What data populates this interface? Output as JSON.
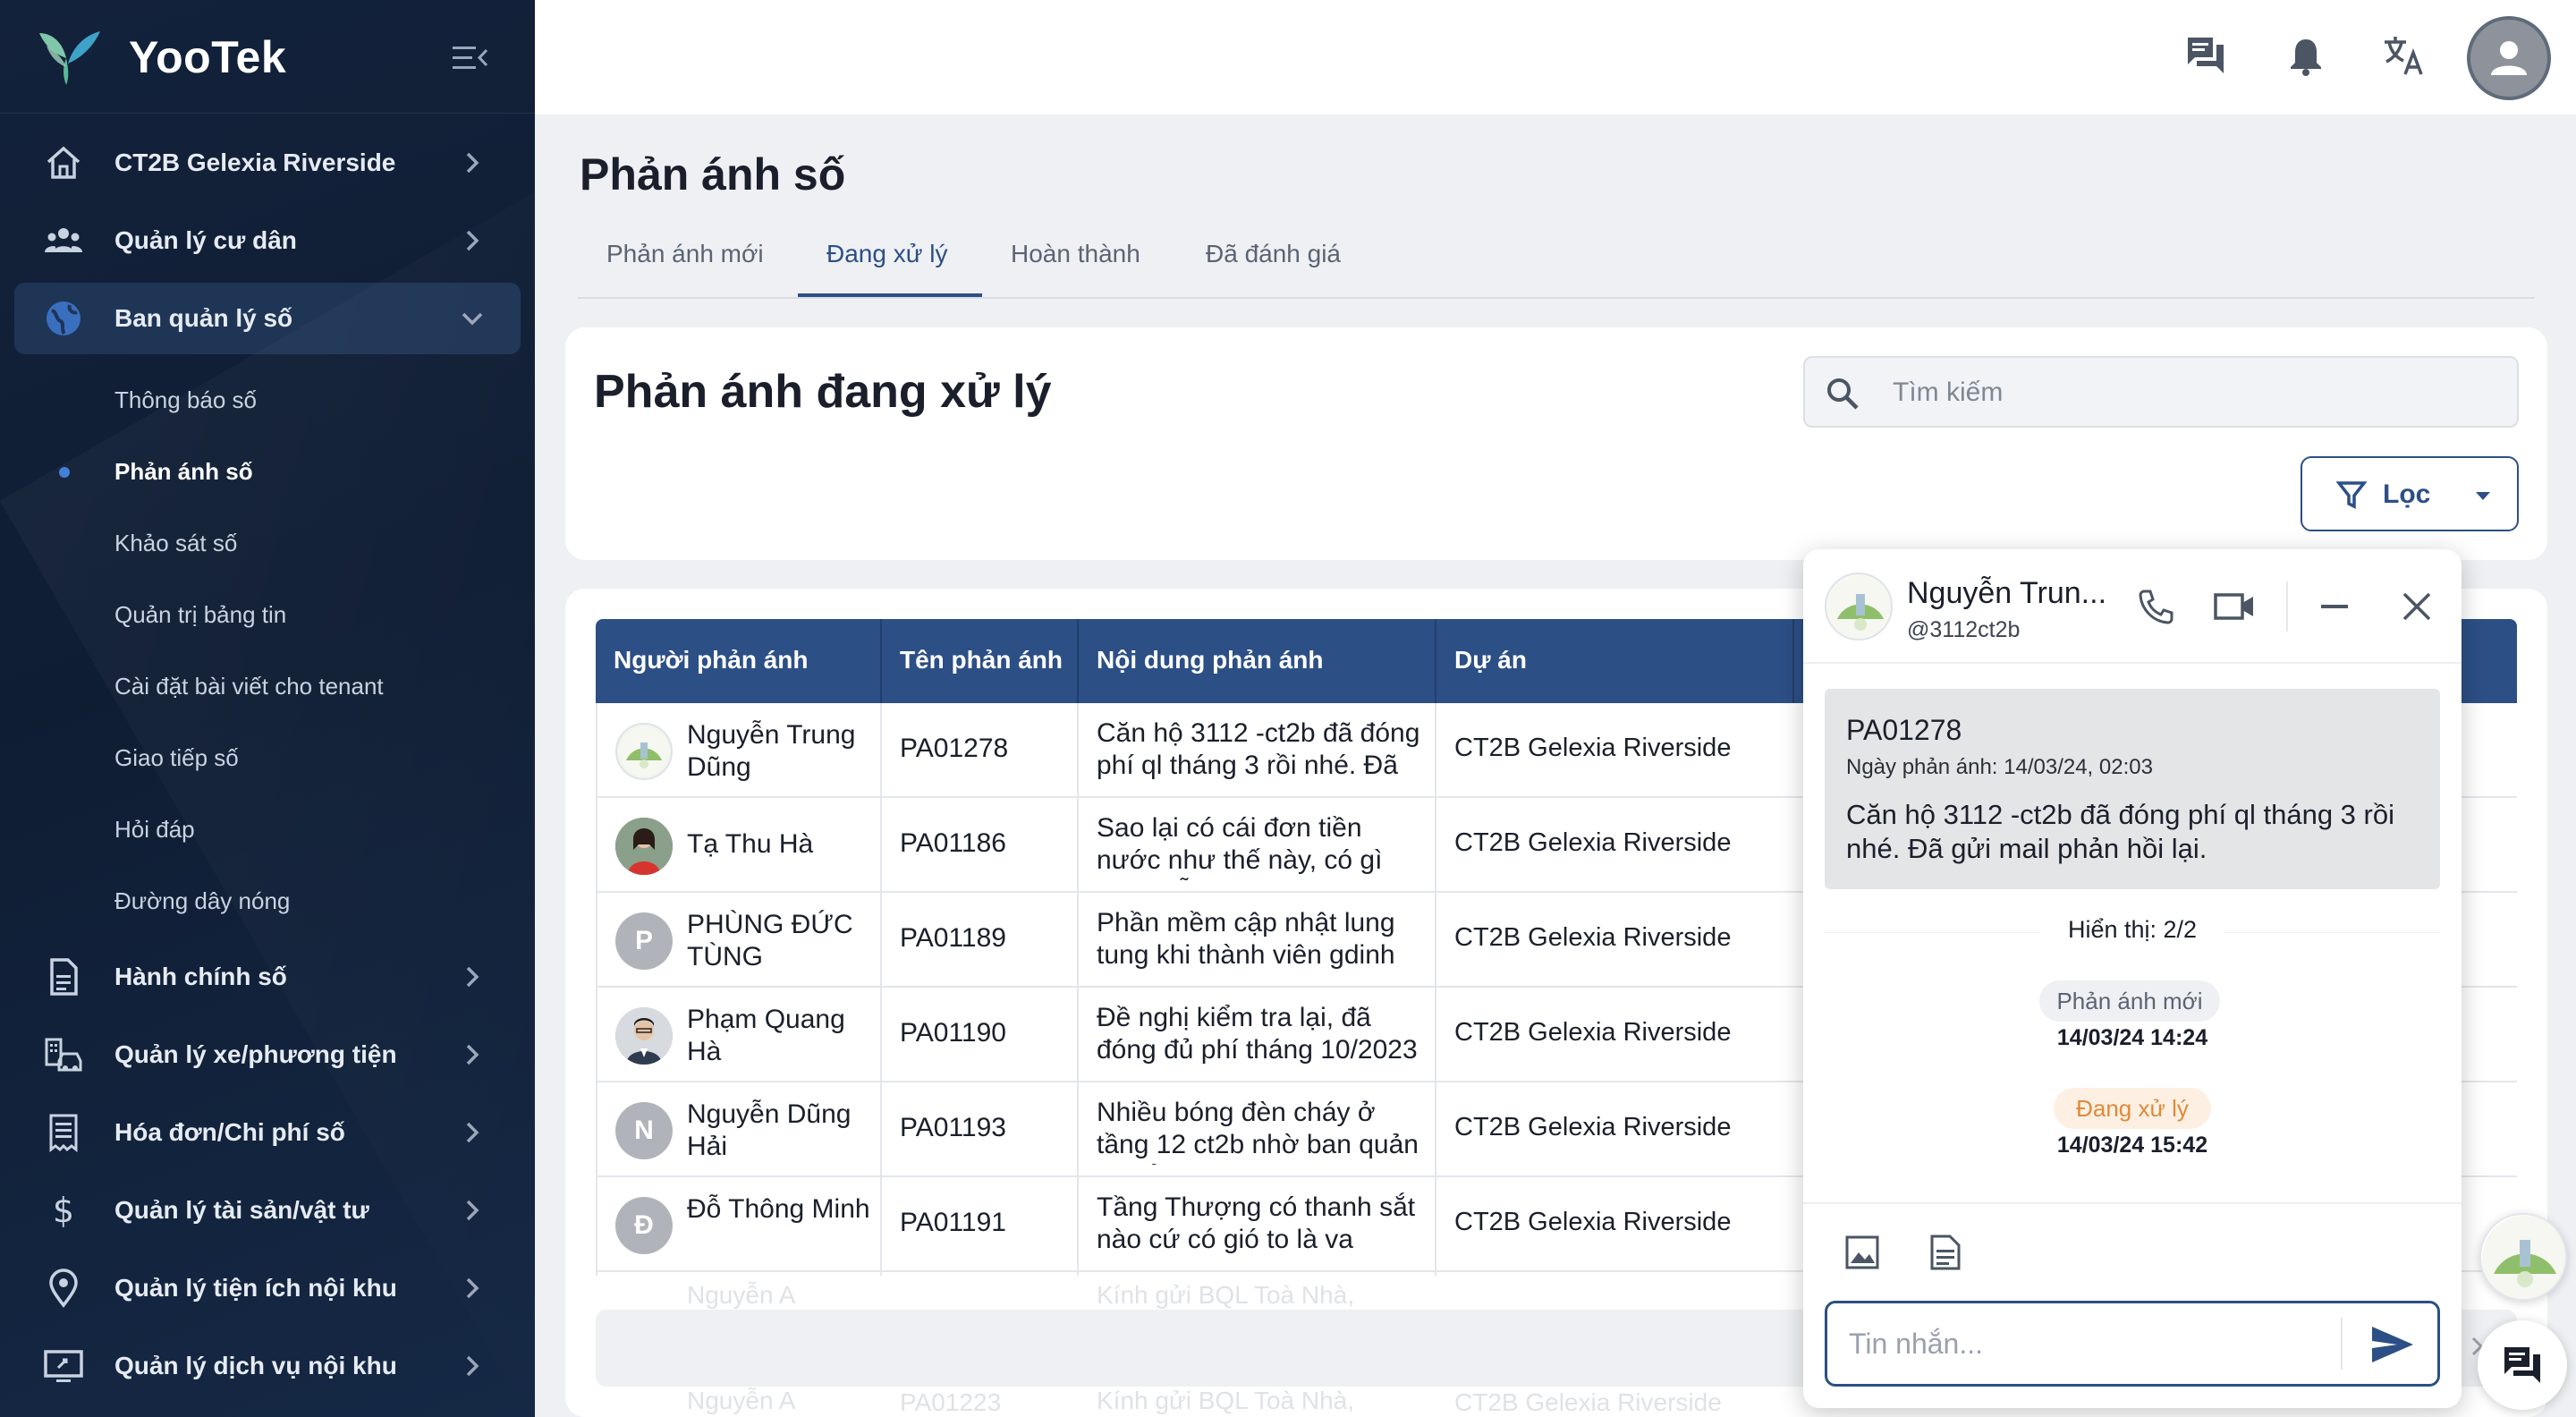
{
  "brand": {
    "name": "YooTek"
  },
  "sidebar": {
    "items": [
      {
        "label": "CT2B Gelexia Riverside",
        "icon": "home-icon"
      },
      {
        "label": "Quản lý cư dân",
        "icon": "people-icon"
      },
      {
        "label": "Ban quản lý số",
        "icon": "globe-icon",
        "expanded": true
      },
      {
        "label": "Hành chính số",
        "icon": "document-icon"
      },
      {
        "label": "Quản lý xe/phương tiện",
        "icon": "vehicle-icon"
      },
      {
        "label": "Hóa đơn/Chi phí số",
        "icon": "receipt-icon"
      },
      {
        "label": "Quản lý tài sản/vật tư",
        "icon": "dollar-icon"
      },
      {
        "label": "Quản lý tiện ích nội khu",
        "icon": "location-icon"
      },
      {
        "label": "Quản lý dịch vụ nội khu",
        "icon": "monitor-icon"
      }
    ],
    "subitems": [
      {
        "label": "Thông báo số"
      },
      {
        "label": "Phản ánh số",
        "current": true
      },
      {
        "label": "Khảo sát số"
      },
      {
        "label": "Quản trị bảng tin"
      },
      {
        "label": "Cài đặt bài viết cho tenant"
      },
      {
        "label": "Giao tiếp số"
      },
      {
        "label": "Hỏi đáp"
      },
      {
        "label": "Đường dây nóng"
      }
    ]
  },
  "page": {
    "title": "Phản ánh số",
    "tabs": [
      {
        "label": "Phản ánh mới"
      },
      {
        "label": "Đang xử lý",
        "active": true
      },
      {
        "label": "Hoàn thành"
      },
      {
        "label": "Đã đánh giá"
      }
    ]
  },
  "filter_card": {
    "title": "Phản ánh đang xử lý",
    "search_placeholder": "Tìm kiếm",
    "filter_label": "Lọc"
  },
  "table": {
    "headers": [
      "Người phản ánh",
      "Tên phản ánh",
      "Nội dung phản ánh",
      "Dự án"
    ],
    "rows": [
      {
        "name": "Nguyễn Trung Dũng",
        "code": "PA01278",
        "content": "Căn hộ 3112 -ct2b đã đóng phí ql tháng 3 rồi nhé. Đã gửi mail phản hồi lại.",
        "project": "CT2B Gelexia Riverside",
        "avatar": "logo"
      },
      {
        "name": "Tạ Thu Hà",
        "code": "PA01186",
        "content": "Sao lại có cái đơn tiền nước như thế này, có gì nhầm lẫn không",
        "project": "CT2B Gelexia Riverside",
        "avatar": "photo"
      },
      {
        "name": "PHÙNG ĐỨC TÙNG",
        "code": "PA01189",
        "content": "Phần mềm cập nhật lung tung khi thành viên gdinh tôi k có ạ nọ này",
        "project": "CT2B Gelexia Riverside",
        "avatar": "P"
      },
      {
        "name": "Phạm Quang Hà",
        "code": "PA01190",
        "content": "Đề nghị kiểm tra lại, đã đóng đủ phí tháng 10/2023",
        "project": "CT2B Gelexia Riverside",
        "avatar": "photo2"
      },
      {
        "name": "Nguyễn Dũng Hải",
        "code": "PA01193",
        "content": "Nhiều bóng đèn cháy ở tầng 12 ct2b nhờ ban quản lý kiểm tra giúp",
        "project": "CT2B Gelexia Riverside",
        "avatar": "N"
      },
      {
        "name": "Đỗ Thông Minh",
        "code": "PA01191",
        "content": "Tầng Thượng có thanh sắt nào cứ có gió to là va chạm xung quanh",
        "project": "CT2B Gelexia Riverside",
        "avatar": "Đ"
      }
    ],
    "faded_rows": [
      {
        "name": "Nguyễn A",
        "code": "PA01223",
        "content": "Kính gửi BQL Toà Nhà,",
        "project": "CT2B Gelexia Riverside"
      }
    ]
  },
  "chat": {
    "name": "Nguyễn Trun...",
    "handle": "@3112ct2b",
    "message": {
      "code": "PA01278",
      "date": "Ngày phản ánh: 14/03/24, 02:03",
      "body": "Căn hộ 3112 -ct2b đã đóng phí ql tháng 3 rồi nhé. Đã gửi mail phản hồi lại."
    },
    "show_count": "Hiển thị: 2/2",
    "statuses": [
      {
        "label": "Phản ánh mới",
        "time": "14/03/24 14:24"
      },
      {
        "label": "Đang xử lý",
        "time": "14/03/24 15:42"
      }
    ],
    "input_placeholder": "Tin nhắn..."
  },
  "colors": {
    "primary": "#2c4f85",
    "sidebar": "#13223b",
    "processing": "#e0893a"
  }
}
